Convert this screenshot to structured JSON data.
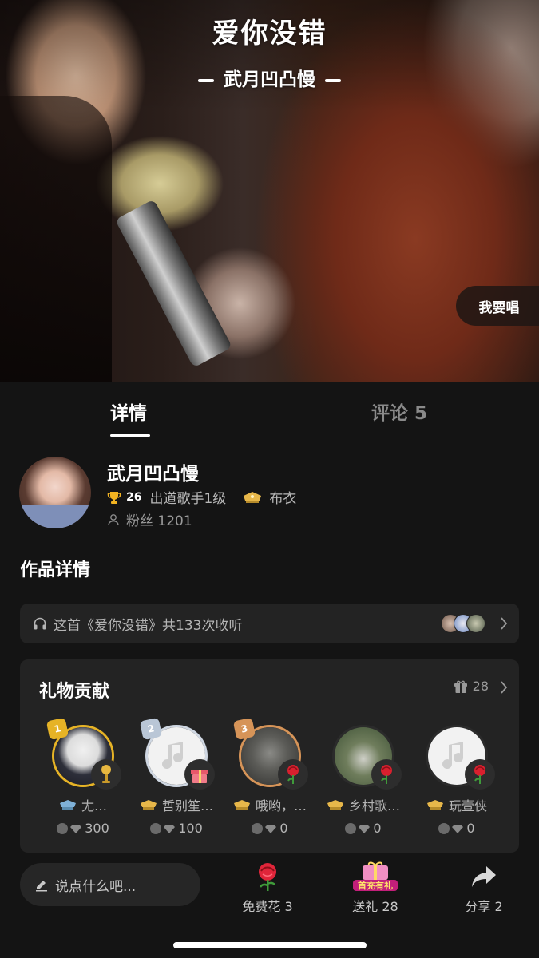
{
  "cover": {
    "song_title": "爱你没错",
    "singer": "武月凹凸慢",
    "sing_button": "我要唱"
  },
  "tabs": [
    {
      "label": "详情",
      "active": true
    },
    {
      "label": "评论 5",
      "active": false
    }
  ],
  "profile": {
    "name": "武月凹凸慢",
    "level": "26",
    "title": "出道歌手1级",
    "rank": "布衣",
    "fans": "粉丝 1201"
  },
  "section_title": "作品详情",
  "listen": {
    "text": "这首《爱你没错》共133次收听"
  },
  "gifts": {
    "title": "礼物贡献",
    "count": "28",
    "contributors": [
      {
        "rank": "1",
        "name": "尢…",
        "value": "300",
        "gift_icon": "microphone-icon"
      },
      {
        "rank": "2",
        "name": "哲别笙…",
        "value": "100",
        "gift_icon": "gift-box-icon"
      },
      {
        "rank": "3",
        "name": "哦哟，…",
        "value": "0",
        "gift_icon": "rose-icon"
      },
      {
        "rank": "",
        "name": "乡村歌…",
        "value": "0",
        "gift_icon": "rose-icon"
      },
      {
        "rank": "",
        "name": "玩壹侠",
        "value": "0",
        "gift_icon": "rose-icon"
      }
    ]
  },
  "bottom": {
    "comment_placeholder": "说点什么吧...",
    "flower": "免费花 3",
    "gift": "送礼 28",
    "gift_promo": "首充有礼",
    "share": "分享 2"
  },
  "colors": {
    "background": "#141414",
    "card": "#232323",
    "gold": "#e6b326",
    "silver": "#cfd7e2",
    "bronze": "#d69458"
  }
}
